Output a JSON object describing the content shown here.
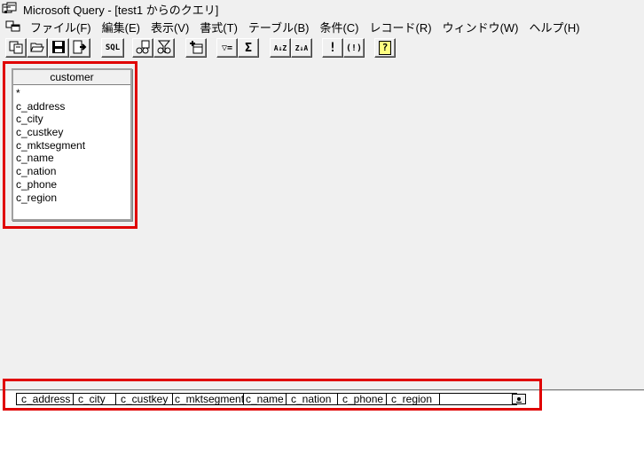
{
  "window": {
    "title": "Microsoft Query - [test1 からのクエリ]"
  },
  "menu": {
    "items": [
      "ファイル(F)",
      "編集(E)",
      "表示(V)",
      "書式(T)",
      "テーブル(B)",
      "条件(C)",
      "レコード(R)",
      "ウィンドウ(W)",
      "ヘルプ(H)"
    ]
  },
  "toolbar": {
    "buttons": [
      "new-query-icon",
      "open-query-icon",
      "save-icon",
      "return-data-icon",
      "sql-icon",
      "show-tables-icon",
      "show-criteria-icon",
      "add-tables-icon",
      "criteria-equals-icon",
      "sum-icon",
      "sort-ascending-icon",
      "sort-descending-icon",
      "query-now-icon",
      "auto-query-icon",
      "help-icon"
    ],
    "sql_label": "SQL",
    "sum_label": "Σ",
    "criteria_label": "▽=",
    "sort_asc_label": "A↓Z",
    "sort_desc_label": "Z↓A",
    "run_label": "!",
    "auto_label": "(!)",
    "help_label": "?"
  },
  "table": {
    "name": "customer",
    "fields": [
      "*",
      "c_address",
      "c_city",
      "c_custkey",
      "c_mktsegment",
      "c_name",
      "c_nation",
      "c_phone",
      "c_region"
    ]
  },
  "grid": {
    "columns": [
      "c_address",
      "c_city",
      "c_custkey",
      "c_mktsegment",
      "c_name",
      "c_nation",
      "c_phone",
      "c_region"
    ]
  },
  "colors": {
    "highlight": "#e00000",
    "background": "#f0f0f0"
  }
}
